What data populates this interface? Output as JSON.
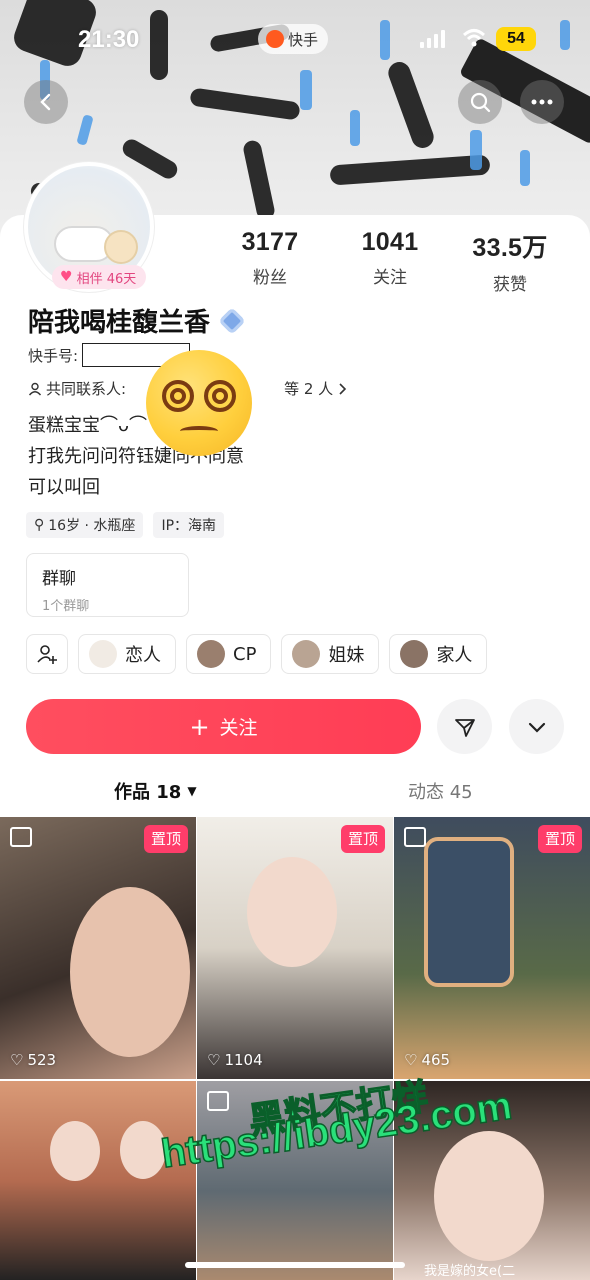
{
  "status_bar": {
    "time": "21:30",
    "app_name": "快手",
    "battery": "54"
  },
  "header": {
    "back_icon": "chevron-left-icon",
    "search_icon": "search-icon",
    "more_icon": "more-icon"
  },
  "profile": {
    "companion_badge": "相伴 46天",
    "nickname": "陪我喝桂馥兰香",
    "kuaishou_id_label": "快手号:",
    "common_contacts_label": "共同联系人:",
    "common_contacts_suffix": "等 2 人",
    "bio_lines": [
      "蛋糕宝宝⌒ᴗ⌒",
      "打我先问问符钰婕同不同意",
      "可以叫回"
    ],
    "tags": {
      "age": "16岁 · 水瓶座",
      "ip": "IP：海南"
    }
  },
  "stats": [
    {
      "num": "3177",
      "label": "粉丝"
    },
    {
      "num": "1041",
      "label": "关注"
    },
    {
      "num": "33.5万",
      "label": "获赞"
    }
  ],
  "group": {
    "title": "群聊",
    "subtitle": "1个群聊"
  },
  "relations": [
    "恋人",
    "CP",
    "姐妹",
    "家人"
  ],
  "actions": {
    "follow_label": "关注"
  },
  "tabs": {
    "works": "作品 18",
    "moments": "动态 45"
  },
  "posts": [
    {
      "pinned": "置顶",
      "likes": "523"
    },
    {
      "pinned": "置顶",
      "likes": "1104"
    },
    {
      "pinned": "置顶",
      "likes": "465"
    },
    {
      "pinned": "",
      "likes": ""
    },
    {
      "pinned": "",
      "likes": ""
    },
    {
      "pinned": "",
      "likes": ""
    }
  ],
  "watermark": {
    "cn": "黑料不打烊",
    "url": "https://ibdy23.com"
  },
  "bottom_text": "我是嫁的女e(二"
}
